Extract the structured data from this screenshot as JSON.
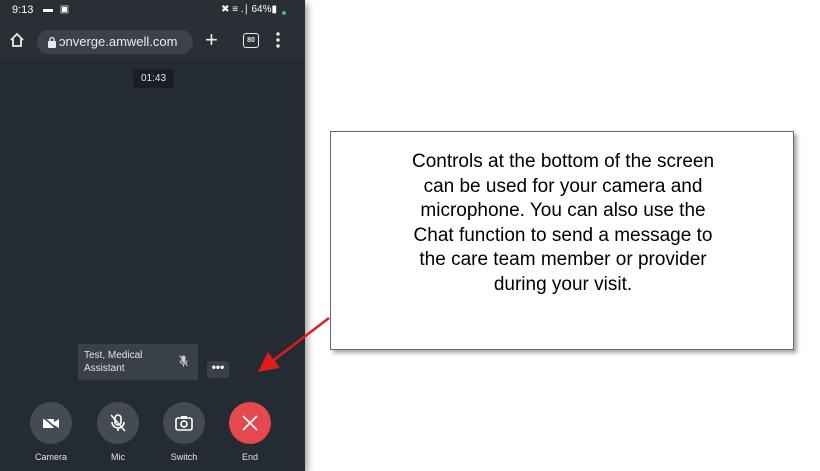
{
  "status_bar": {
    "time": "9:13",
    "left_icons": "▬ ▣",
    "right_status": "✖ ≡ .∣ 64%▮"
  },
  "browser": {
    "url": "ɔnverge.amwell.com",
    "tab_count": "80"
  },
  "call": {
    "timer": "01:43",
    "participant_name": "Test, Medical Assistant",
    "more_label": "•••"
  },
  "controls": [
    {
      "label": "Camera",
      "icon": "video-camera-icon"
    },
    {
      "label": "Mic",
      "icon": "mic-off-icon"
    },
    {
      "label": "Switch",
      "icon": "switch-camera-icon"
    },
    {
      "label": "End",
      "icon": "close-icon"
    }
  ],
  "callout": {
    "text": "Controls at the bottom of the screen\ncan be used for your camera and\nmicrophone.  You can also use the\nChat function to send a message to\nthe care team member or provider\nduring your visit."
  },
  "colors": {
    "end_button": "#e5484d",
    "arrow": "#e01b1b",
    "call_background": "#252b33"
  }
}
